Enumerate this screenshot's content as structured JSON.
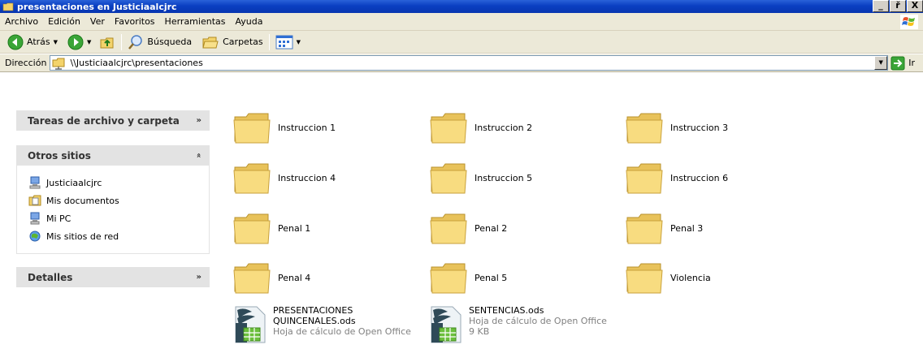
{
  "window": {
    "title": "presentaciones en Justiciaalcjrc",
    "buttons": [
      "_",
      "ř",
      "X"
    ]
  },
  "menu": [
    "Archivo",
    "Edición",
    "Ver",
    "Favoritos",
    "Herramientas",
    "Ayuda"
  ],
  "toolbar": {
    "back_label": "Atrás",
    "search_label": "Búsqueda",
    "folders_label": "Carpetas"
  },
  "address": {
    "label": "Dirección",
    "value": "\\\\Justiciaalcjrc\\presentaciones",
    "go_label": "Ir"
  },
  "taskpane": {
    "file_tasks": {
      "title": "Tareas de archivo y carpeta"
    },
    "other_places": {
      "title": "Otros sitios",
      "items": [
        {
          "label": "Justiciaalcjrc",
          "icon": "network-computer-icon"
        },
        {
          "label": "Mis documentos",
          "icon": "my-documents-icon"
        },
        {
          "label": "Mi PC",
          "icon": "my-computer-icon"
        },
        {
          "label": "Mis sitios de red",
          "icon": "network-places-icon"
        }
      ]
    },
    "details": {
      "title": "Detalles"
    }
  },
  "folders": [
    "Instruccion 1",
    "Instruccion 2",
    "Instruccion 3",
    "Instruccion 4",
    "Instruccion 5",
    "Instruccion 6",
    "Penal 1",
    "Penal 2",
    "Penal 3",
    "Penal 4",
    "Penal 5",
    "Violencia"
  ],
  "documents": [
    {
      "name_line1": "PRESENTACIONES",
      "name_line2": "QUINCENALES.ods",
      "type": "Hoja de cálculo de Open Office",
      "size": ""
    },
    {
      "name_line1": "SENTENCIAS.ods",
      "name_line2": "",
      "type": "Hoja de cálculo de Open Office",
      "size": "9 KB"
    }
  ],
  "colors": {
    "titlebar": "#0a3fc2",
    "chrome": "#ece9d8",
    "panel_header": "#e3e3e3",
    "folder": "#f5d97a"
  }
}
